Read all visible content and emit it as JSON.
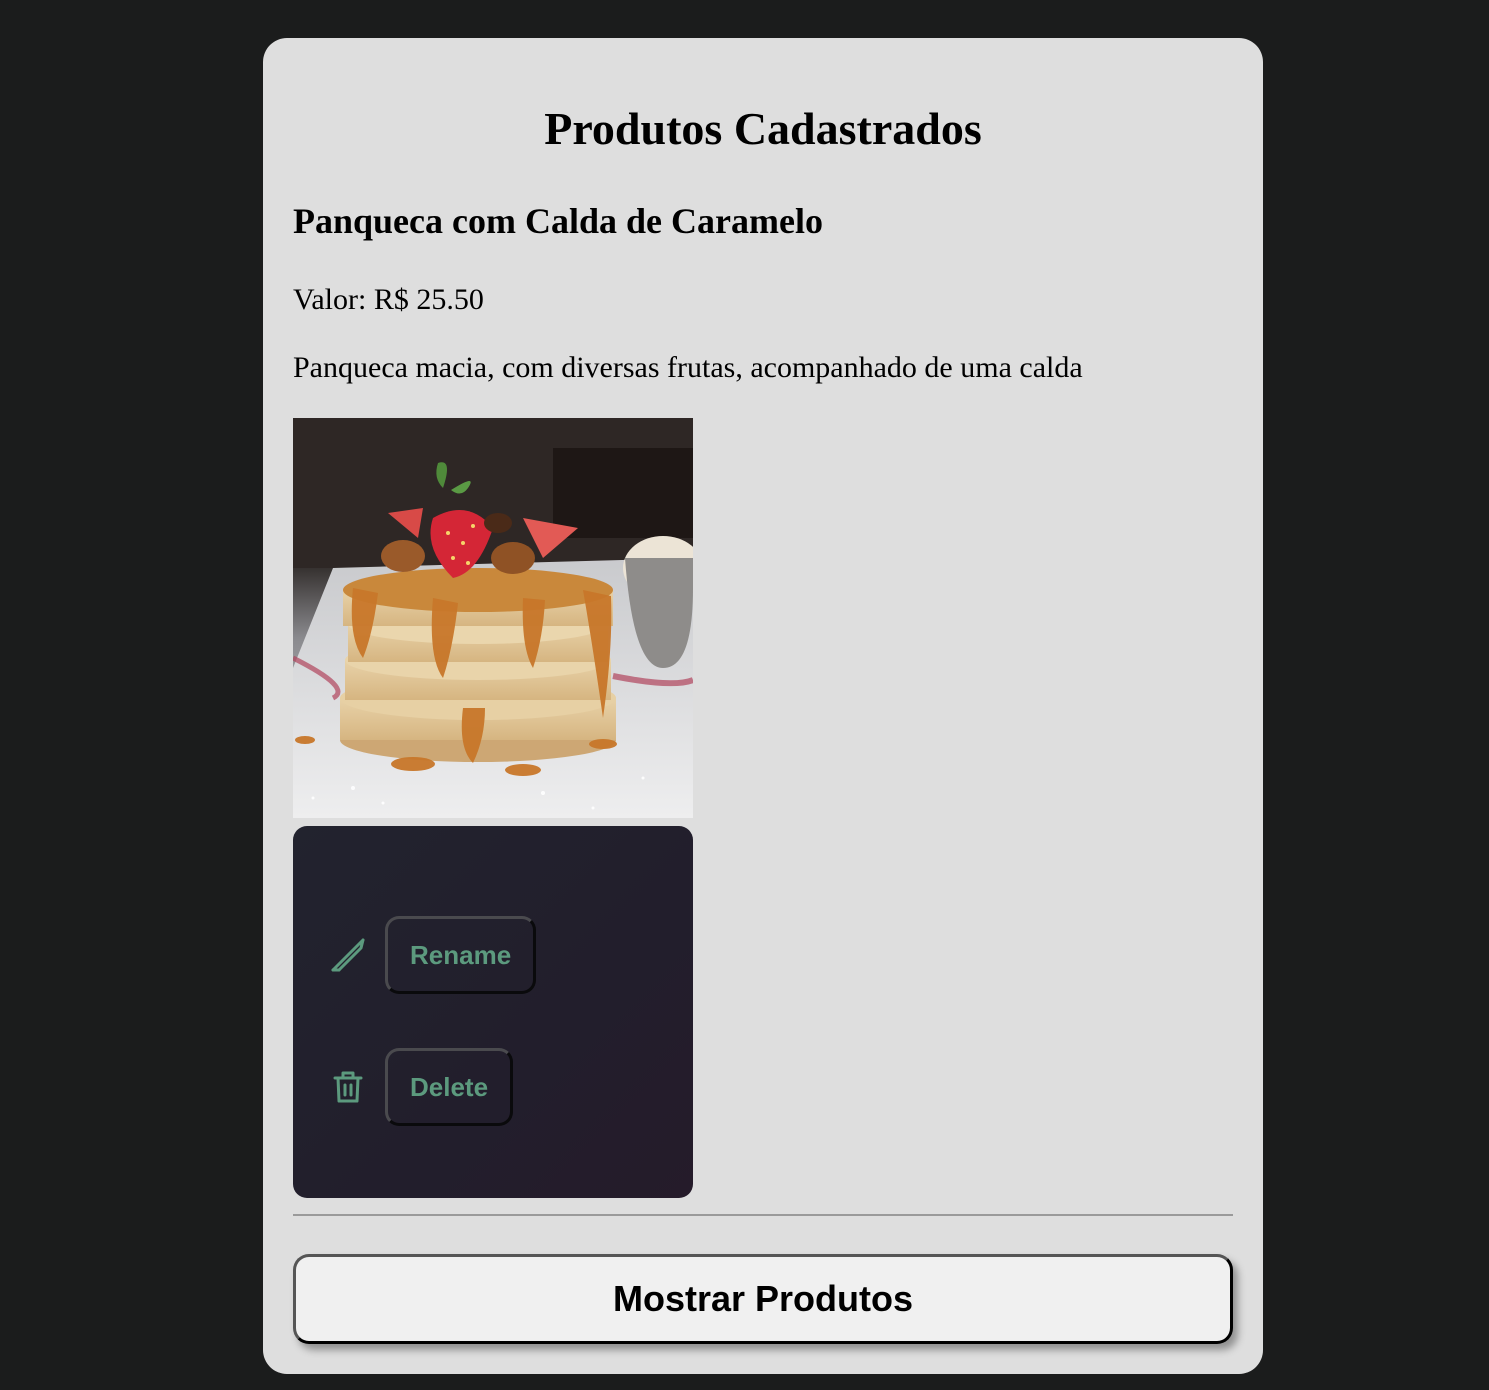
{
  "page": {
    "title": "Produtos Cadastrados"
  },
  "product": {
    "name": "Panqueca com Calda de Caramelo",
    "price_text": "Valor: R$ 25.50",
    "description": "Panqueca macia, com diversas frutas, acompanhado de uma calda",
    "image_icon": "pancake-photo"
  },
  "menu": {
    "rename_label": "Rename",
    "rename_icon": "pencil-icon",
    "delete_label": "Delete",
    "delete_icon": "trash-icon",
    "accent_color": "#5c9a7e"
  },
  "actions": {
    "show_products_label": "Mostrar Produtos"
  },
  "colors": {
    "background": "#1b1c1c",
    "card": "#dedede",
    "menu_panel": "#22232e"
  }
}
